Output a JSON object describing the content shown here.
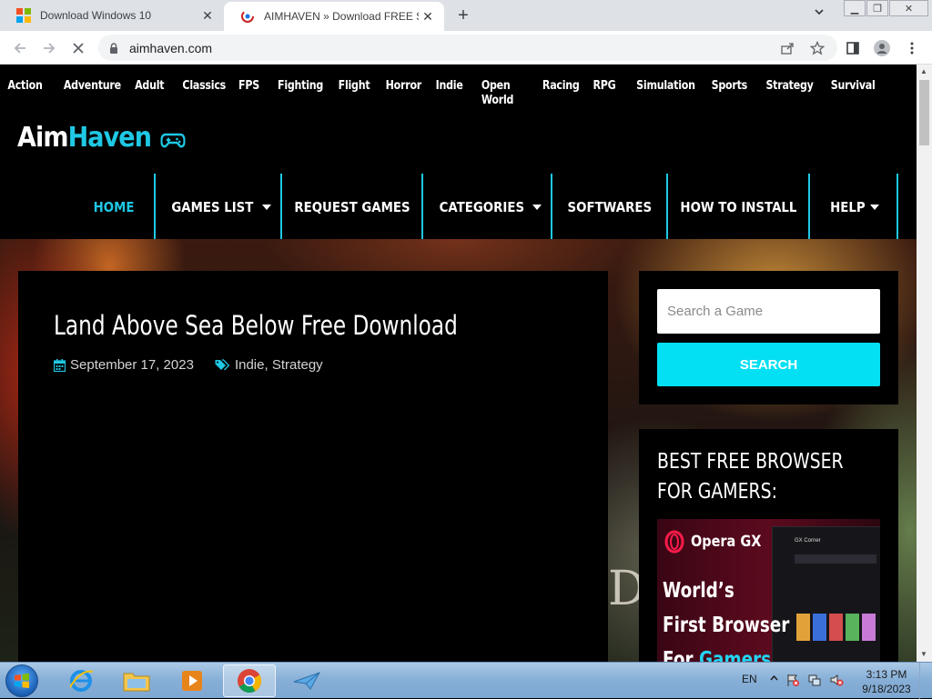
{
  "browser": {
    "tabs": [
      {
        "title": "Download Windows 10",
        "active": false
      },
      {
        "title": "AIMHAVEN » Download FREE Ste",
        "active": true
      }
    ],
    "new_tab": "+",
    "tab_menu": "⌄",
    "url": "aimhaven.com"
  },
  "site": {
    "top_categories": [
      "Action",
      "Adventure",
      "Adult",
      "Classics",
      "FPS",
      "Fighting",
      "Flight",
      "Horror",
      "Indie",
      "Open World",
      "Racing",
      "RPG",
      "Simulation",
      "Sports",
      "Strategy",
      "Survival"
    ],
    "logo": {
      "part1": "Aim",
      "part2": "Haven"
    },
    "nav": [
      {
        "label": "HOME",
        "active": true,
        "dropdown": false
      },
      {
        "label": "GAMES LIST",
        "active": false,
        "dropdown": true
      },
      {
        "label": "REQUEST GAMES",
        "active": false,
        "dropdown": false
      },
      {
        "label": "CATEGORIES",
        "active": false,
        "dropdown": true
      },
      {
        "label": "SOFTWARES",
        "active": false,
        "dropdown": false
      },
      {
        "label": "HOW TO INSTALL",
        "active": false,
        "dropdown": false
      },
      {
        "label": "HELP",
        "active": false,
        "dropdown": true
      }
    ],
    "hero_letters": "D",
    "article": {
      "title": "Land Above Sea Below Free Download",
      "date": "September 17, 2023",
      "category1": "Indie",
      "category_sep": ", ",
      "category2": "Strategy"
    },
    "sidebar": {
      "search_placeholder": "Search a Game",
      "search_button": "SEARCH",
      "browser_heading": "BEST FREE BROWSER FOR GAMERS:",
      "ad_brand": "Opera GX",
      "ad_line1": "World’s",
      "ad_line2": "First Browser",
      "ad_line3a": "For ",
      "ad_line3b": "Gamers",
      "ad_corner": "GX Corner"
    }
  },
  "taskbar": {
    "language": "EN",
    "time": "3:13 PM",
    "date": "9/18/2023"
  },
  "colors": {
    "accent": "#1fc8e4",
    "search_button": "#04e0f3",
    "page_bg": "#000000"
  }
}
